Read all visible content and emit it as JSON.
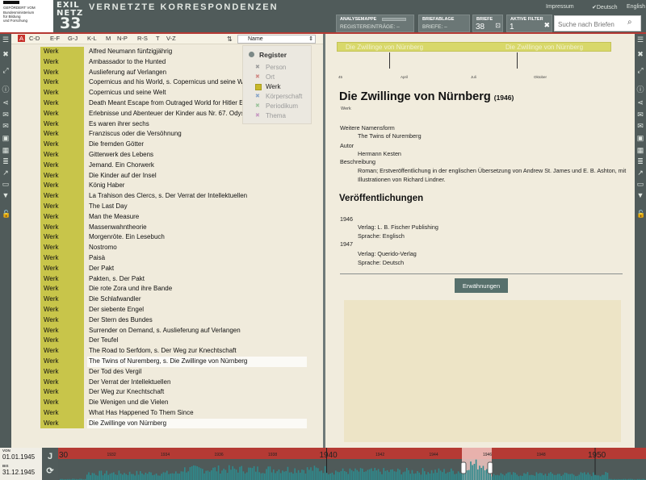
{
  "header": {
    "ministry_lines": [
      "GEFÖRDERT VOM",
      "Bundesministerium",
      "für Bildung",
      "und Forschung"
    ],
    "logo": {
      "line1": "EXIL",
      "line2": "NETZ",
      "line3": "33"
    },
    "title": "VERNETZTE KORRESPONDENZEN",
    "links": {
      "impressum": "Impressum",
      "deutsch": "Deutsch",
      "english": "English"
    },
    "analysemappe": {
      "label": "ANALYSEMAPPE",
      "sub": "REGISTEREINTRÄGE: –"
    },
    "briefablage": {
      "label": "BRIEFABLAGE",
      "sub": "BRIEFE: –"
    },
    "briefe": {
      "label": "BRIEFE",
      "value": "38"
    },
    "aktive_filter": {
      "label": "AKTIVE FILTER",
      "value": "1"
    },
    "search_placeholder": "Suche nach Briefen"
  },
  "alphabet": [
    "A",
    "C-D",
    "E-F",
    "G-J",
    "K-L",
    "M",
    "N-P",
    "R-S",
    "T",
    "V-Z"
  ],
  "sort": {
    "value": "Name"
  },
  "register": {
    "title": "Register",
    "items": [
      {
        "label": "Person",
        "checked": false
      },
      {
        "label": "Ort",
        "checked": false
      },
      {
        "label": "Werk",
        "checked": true
      },
      {
        "label": "Körperschaft",
        "checked": false
      },
      {
        "label": "Periodikum",
        "checked": false
      },
      {
        "label": "Thema",
        "checked": false
      }
    ]
  },
  "list": [
    {
      "type": "Werk",
      "name": "Alfred Neumann fünfzigjährig"
    },
    {
      "type": "Werk",
      "name": "Ambassador to the Hunted"
    },
    {
      "type": "Werk",
      "name": "Auslieferung auf Verlangen"
    },
    {
      "type": "Werk",
      "name": "Copernicus and his World, s. Copernicus und seine Welt"
    },
    {
      "type": "Werk",
      "name": "Copernicus und seine Welt"
    },
    {
      "type": "Werk",
      "name": "Death Meant Escape from Outraged World for Hitler Exiles"
    },
    {
      "type": "Werk",
      "name": "Erlebnisse und Abenteuer der Kinder aus Nr. 67. Odyssee"
    },
    {
      "type": "Werk",
      "name": "Es waren ihrer sechs"
    },
    {
      "type": "Werk",
      "name": "Franziscus oder die Versöhnung"
    },
    {
      "type": "Werk",
      "name": "Die fremden Götter"
    },
    {
      "type": "Werk",
      "name": "Gitterwerk des Lebens"
    },
    {
      "type": "Werk",
      "name": "Jemand. Ein Chorwerk"
    },
    {
      "type": "Werk",
      "name": "Die Kinder auf der Insel"
    },
    {
      "type": "Werk",
      "name": "König Haber"
    },
    {
      "type": "Werk",
      "name": "La Trahison des Clercs, s. Der Verrat der Intellektuellen"
    },
    {
      "type": "Werk",
      "name": "The Last Day"
    },
    {
      "type": "Werk",
      "name": "Man the Measure"
    },
    {
      "type": "Werk",
      "name": "Massenwahntheorie"
    },
    {
      "type": "Werk",
      "name": "Morgenröte. Ein Lesebuch"
    },
    {
      "type": "Werk",
      "name": "Nostromo"
    },
    {
      "type": "Werk",
      "name": "Paisà"
    },
    {
      "type": "Werk",
      "name": "Der Pakt"
    },
    {
      "type": "Werk",
      "name": "Pakten, s. Der Pakt"
    },
    {
      "type": "Werk",
      "name": "Die rote Zora und ihre Bande"
    },
    {
      "type": "Werk",
      "name": "Die Schlafwandler"
    },
    {
      "type": "Werk",
      "name": "Der siebente Engel"
    },
    {
      "type": "Werk",
      "name": "Der Stern des Bundes"
    },
    {
      "type": "Werk",
      "name": "Surrender on Demand, s. Auslieferung auf Verlangen"
    },
    {
      "type": "Werk",
      "name": "Der Teufel"
    },
    {
      "type": "Werk",
      "name": "The Road to Serfdom, s. Der Weg zur Knechtschaft"
    },
    {
      "type": "Werk",
      "name": "The Twins of Nuremberg, s. Die Zwillinge von Nürnberg",
      "highlight": true
    },
    {
      "type": "Werk",
      "name": "Der Tod des Vergil"
    },
    {
      "type": "Werk",
      "name": "Der Verrat der Intellektuellen"
    },
    {
      "type": "Werk",
      "name": "Der Weg zur Knechtschaft"
    },
    {
      "type": "Werk",
      "name": "Die Wenigen und die Vielen"
    },
    {
      "type": "Werk",
      "name": "What Has Happened To Them Since"
    },
    {
      "type": "Werk",
      "name": "Die Zwillinge von Nürnberg",
      "highlight": true
    }
  ],
  "detail": {
    "mini_timeline_labels": [
      "Die Zwillinge von Nürnberg",
      "Die Zwillinge von Nürnberg"
    ],
    "mini_axis": [
      "45",
      "April",
      "Juli",
      "Oktober"
    ],
    "title": "Die Zwillinge von Nürnberg",
    "year": "(1946)",
    "kind": "Werk",
    "fields": [
      {
        "label": "Weitere Namensform",
        "value": "The Twins of Nuremberg"
      },
      {
        "label": "Autor",
        "value": "Hermann Kesten"
      },
      {
        "label": "Beschreibung",
        "value": "Roman; Erstveröffentlichung in der englischen Übersetzung von Andrew St. James und E. B. Ashton, mit Illustrationen von Richard Lindner."
      }
    ],
    "publications_heading": "Veröffentlichungen",
    "publications": [
      {
        "year": "1946",
        "verlag": "Verlag: L. B. Fischer Publishing",
        "sprache": "Sprache: Englisch"
      },
      {
        "year": "1947",
        "verlag": "Verlag: Querido-Verlag",
        "sprache": "Sprache: Deutsch"
      }
    ],
    "mentions_button": "Erwähnungen"
  },
  "timeline": {
    "von_label": "VON",
    "von": "01.01.1945",
    "bis_label": "BIS",
    "bis": "31.12.1945",
    "j_button": "J",
    "major_years": [
      "1940",
      "1950"
    ],
    "minor_years": [
      "1932",
      "1934",
      "1936",
      "1938",
      "1942",
      "1944",
      "1946",
      "1948"
    ],
    "left_partial": "30"
  }
}
